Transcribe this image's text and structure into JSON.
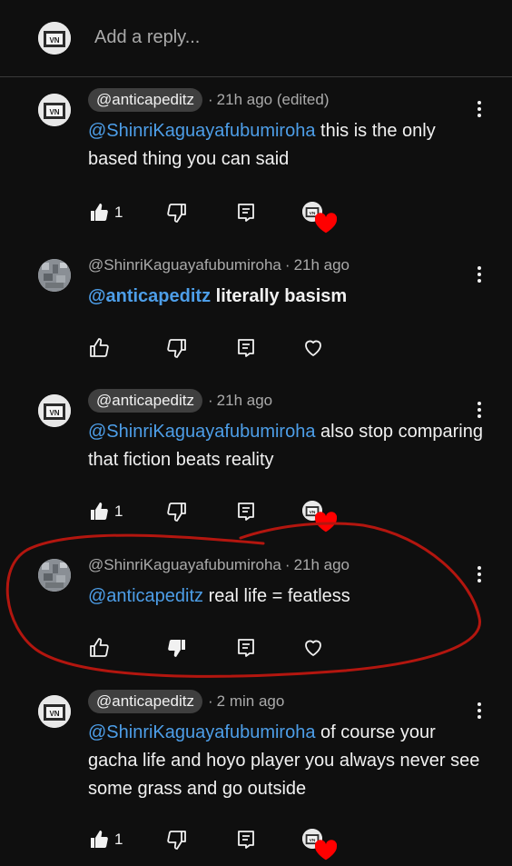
{
  "reply_bar": {
    "placeholder": "Add a reply..."
  },
  "comments": [
    {
      "author": "@anticapeditz",
      "author_chip": true,
      "time": "21h ago (edited)",
      "mention": "@ShinriKaguayafubumiroha",
      "text": " this is the only based thing you can said",
      "bold": false,
      "likes": "1",
      "liked": true,
      "disliked": false,
      "creator_heart": true
    },
    {
      "author": "@ShinriKaguayafubumiroha",
      "author_chip": false,
      "time": "21h ago",
      "mention": "@anticapeditz",
      "text": " literally basism",
      "bold": true,
      "likes": "",
      "liked": false,
      "disliked": false,
      "creator_heart": false
    },
    {
      "author": "@anticapeditz",
      "author_chip": true,
      "time": "21h ago",
      "mention": "@ShinriKaguayafubumiroha",
      "text": " also stop comparing that fiction beats reality",
      "bold": false,
      "likes": "1",
      "liked": true,
      "disliked": false,
      "creator_heart": true
    },
    {
      "author": "@ShinriKaguayafubumiroha",
      "author_chip": false,
      "time": "21h ago",
      "mention": "@anticapeditz",
      "text": " real life = featless",
      "bold": false,
      "likes": "",
      "liked": false,
      "disliked": true,
      "creator_heart": false
    },
    {
      "author": "@anticapeditz",
      "author_chip": true,
      "time": "2 min ago",
      "mention": "@ShinriKaguayafubumiroha",
      "text": " of course your gacha life and hoyo player you always never see some grass and go outside",
      "bold": false,
      "likes": "1",
      "liked": true,
      "disliked": false,
      "creator_heart": true
    }
  ],
  "colors": {
    "background": "#0f0f0f",
    "mention": "#4d9ee8",
    "meta": "#aaaaaa",
    "annotation_circle": "#b3160f",
    "heart": "#ff0000"
  },
  "icons": {
    "like": "thumbs-up-icon",
    "dislike": "thumbs-down-icon",
    "reply": "reply-icon",
    "heart": "heart-icon",
    "more": "kebab-menu-icon"
  }
}
